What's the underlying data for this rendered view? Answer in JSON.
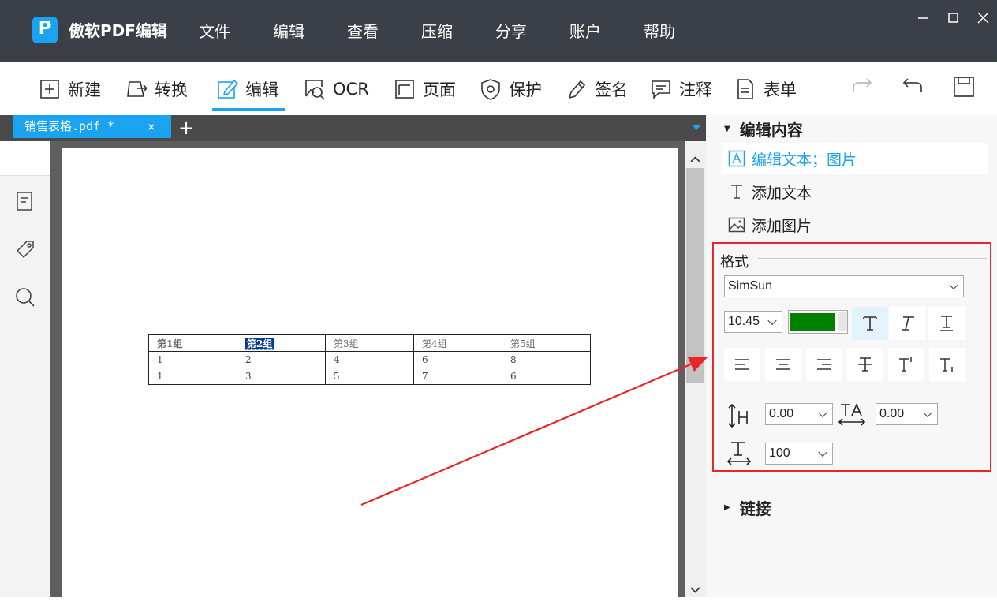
{
  "app": {
    "logo_letter": "P",
    "name": "傲软PDF编辑",
    "menu": [
      "文件",
      "编辑",
      "查看",
      "压缩",
      "分享",
      "账户",
      "帮助"
    ]
  },
  "toolbar": {
    "items": [
      {
        "label": "新建",
        "icon": "plus-square-icon"
      },
      {
        "label": "转换",
        "icon": "convert-icon"
      },
      {
        "label": "编辑",
        "icon": "edit-icon",
        "active": true
      },
      {
        "label": "OCR",
        "icon": "ocr-icon"
      },
      {
        "label": "页面",
        "icon": "page-icon"
      },
      {
        "label": "保护",
        "icon": "shield-icon"
      },
      {
        "label": "签名",
        "icon": "pen-icon"
      },
      {
        "label": "注释",
        "icon": "comment-icon"
      },
      {
        "label": "表单",
        "icon": "form-icon"
      }
    ],
    "right_icons": [
      "redo-icon",
      "undo-icon",
      "save-icon"
    ]
  },
  "tab": {
    "title": "销售表格.pdf *",
    "close": "×",
    "add": "+"
  },
  "document": {
    "table": {
      "header": [
        "第1组",
        "第2组",
        "第3组",
        "第4组",
        "第5组"
      ],
      "rows": [
        [
          "1",
          "2",
          "4",
          "6",
          "8"
        ],
        [
          "1",
          "3",
          "5",
          "7",
          "6"
        ]
      ]
    }
  },
  "panel": {
    "edit_section": "编辑内容",
    "items": [
      "编辑文本；图片",
      "添加文本",
      "添加图片"
    ],
    "format": {
      "title": "格式",
      "font": "SimSun",
      "size": "10.45",
      "color": "#008000",
      "line_spacing": "0.00",
      "char_spacing": "0.00",
      "scale": "100"
    },
    "link_section": "链接"
  },
  "colors": {
    "accent": "#1aa3f0",
    "highlight_border": "#e8262a",
    "titlebar": "#3b4048"
  }
}
